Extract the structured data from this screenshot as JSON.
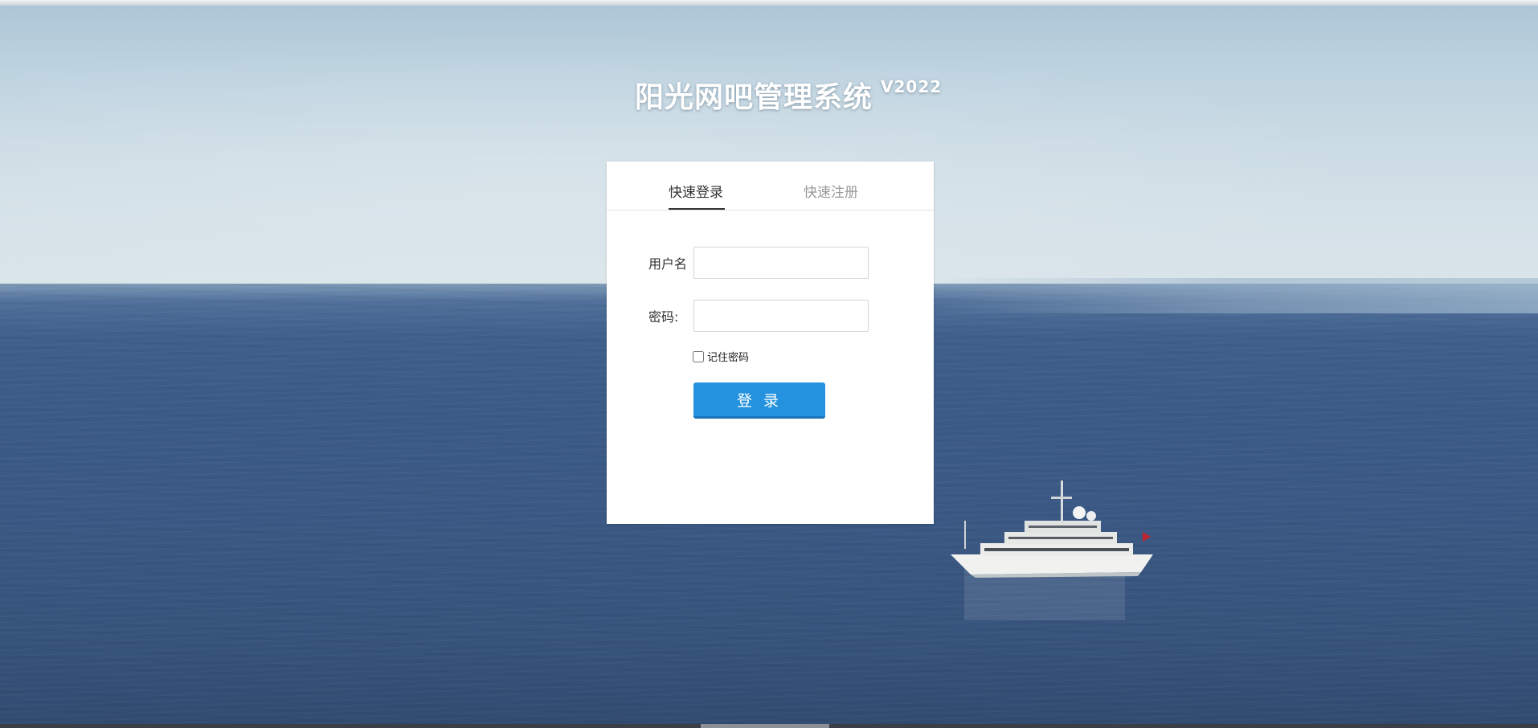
{
  "header": {
    "title": "阳光网吧管理系统",
    "version": "V2022"
  },
  "tabs": [
    {
      "label": "快速登录",
      "active": true
    },
    {
      "label": "快速注册",
      "active": false
    }
  ],
  "form": {
    "username_label": "用户名",
    "username_value": "",
    "password_label": "密码:",
    "password_value": "",
    "remember_label": "记住密码",
    "remember_checked": false,
    "login_button": "登 录"
  },
  "colors": {
    "accent": "#2492de",
    "card_bg": "#ffffff"
  }
}
